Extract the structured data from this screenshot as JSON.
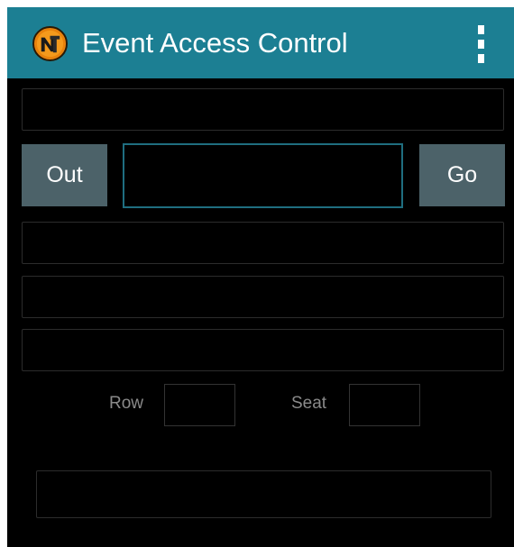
{
  "app": {
    "title": "Event Access Control",
    "logo_icon": "nt-logo-icon",
    "menu_icon": "overflow-menu-icon",
    "colors": {
      "action_bar": "#1c7f93",
      "button": "#4c6269",
      "accent_border": "#1f6e80",
      "background": "#000000"
    }
  },
  "controls": {
    "out_label": "Out",
    "go_label": "Go",
    "scan_value": ""
  },
  "seat": {
    "row_label": "Row",
    "seat_label": "Seat",
    "row_value": "",
    "seat_value": ""
  },
  "fields": {
    "top_value": "",
    "info_1": "",
    "info_2": "",
    "info_3": "",
    "status": ""
  }
}
